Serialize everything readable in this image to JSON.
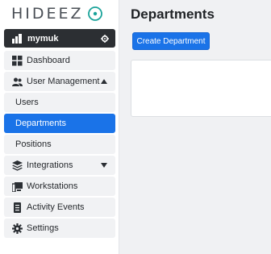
{
  "brand": {
    "logo_text": "HIDEEZ"
  },
  "org": {
    "name": "mymuk"
  },
  "sidebar": {
    "items": [
      {
        "label": "Dashboard"
      },
      {
        "label": "User Management"
      },
      {
        "label": "Users"
      },
      {
        "label": "Departments"
      },
      {
        "label": "Positions"
      },
      {
        "label": "Integrations"
      },
      {
        "label": "Workstations"
      },
      {
        "label": "Activity Events"
      },
      {
        "label": "Settings"
      }
    ]
  },
  "page": {
    "title": "Departments"
  },
  "actions": {
    "create_label": "Create Department"
  },
  "colors": {
    "accent": "#1a73e8",
    "org_bg": "#2c2f33",
    "logo_accent": "#1aa39a"
  }
}
